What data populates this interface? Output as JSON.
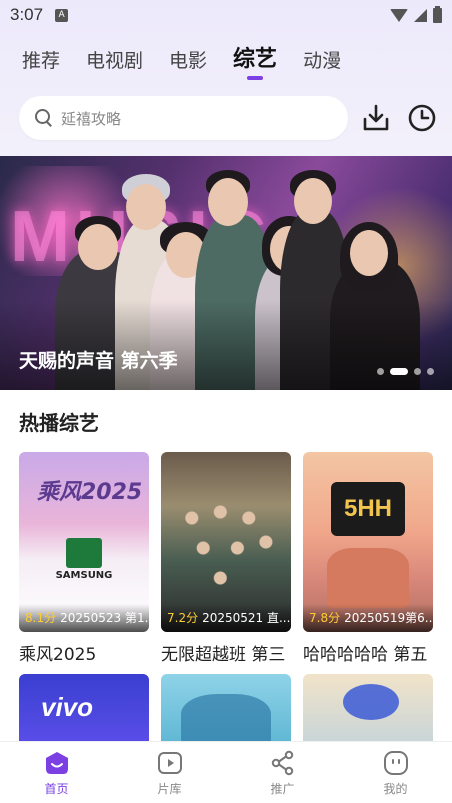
{
  "status_bar": {
    "time": "3:07",
    "notification_icon": "A"
  },
  "top_tabs": [
    {
      "label": "推荐",
      "active": false
    },
    {
      "label": "电视剧",
      "active": false
    },
    {
      "label": "电影",
      "active": false
    },
    {
      "label": "综艺",
      "active": true
    },
    {
      "label": "动漫",
      "active": false
    }
  ],
  "search": {
    "placeholder": "延禧攻略"
  },
  "header_icons": {
    "download": "download-icon",
    "history": "history-icon"
  },
  "banner": {
    "title": "天赐的声音 第六季",
    "neon_text": "MUSIC",
    "dot_count": 4,
    "active_dot": 1
  },
  "section": {
    "title": "热播综艺"
  },
  "cards": [
    {
      "score": "8.1分",
      "info": "20250523 第1...",
      "title": "乘风2025",
      "poster_text": "乘风2025",
      "sponsor": "SAMSUNG"
    },
    {
      "score": "7.2分",
      "info": "20250521 直...",
      "title": "无限超越班 第三"
    },
    {
      "score": "7.8分",
      "info": "20250519第6...",
      "title": "哈哈哈哈哈 第五",
      "poster_text": "5HH"
    }
  ],
  "row2_cards": [
    {
      "poster_text": "vivo"
    },
    {
      "poster_text": ""
    },
    {
      "poster_text": ""
    }
  ],
  "bottom_nav": [
    {
      "label": "首页",
      "icon": "home-icon",
      "active": true
    },
    {
      "label": "片库",
      "icon": "video-library-icon",
      "active": false
    },
    {
      "label": "推广",
      "icon": "share-icon",
      "active": false
    },
    {
      "label": "我的",
      "icon": "profile-icon",
      "active": false
    }
  ],
  "colors": {
    "accent": "#7b3fe4",
    "score": "#ffcc33"
  }
}
